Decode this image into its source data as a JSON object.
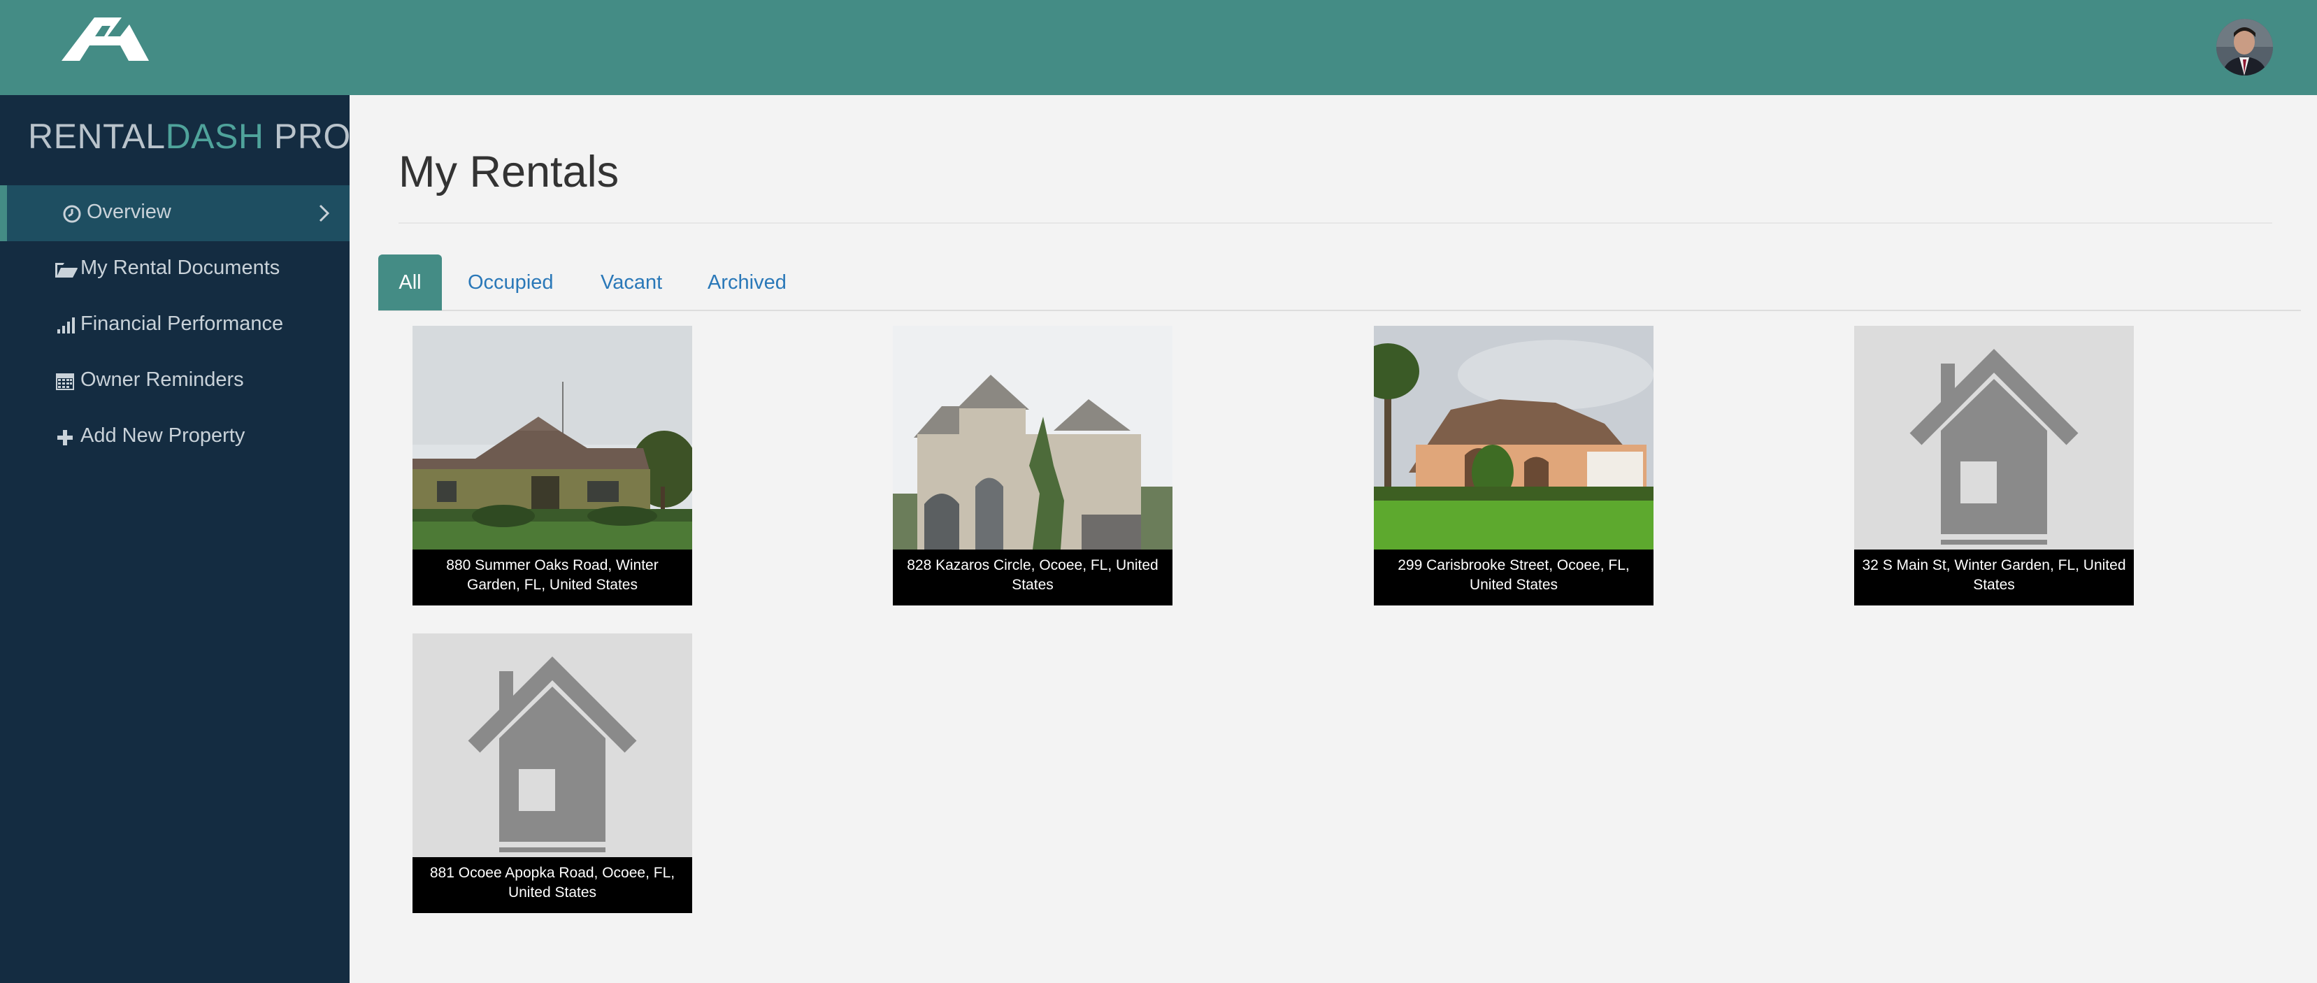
{
  "app": {
    "brand_part1": "RENTAL",
    "brand_part2": "DASH",
    "brand_part3": " PRO",
    "accent_color": "#448c85",
    "sidebar_color": "#142c41"
  },
  "header": {
    "logo_icon": "house-roof-logo-icon",
    "avatar_icon": "user-avatar"
  },
  "sidebar": {
    "items": [
      {
        "label": "Overview",
        "icon": "clock-icon",
        "active": true
      },
      {
        "label": "My Rental Documents",
        "icon": "folder-open-icon"
      },
      {
        "label": "Financial Performance",
        "icon": "bar-chart-icon"
      },
      {
        "label": "Owner Reminders",
        "icon": "calendar-icon"
      },
      {
        "label": "Add New Property",
        "icon": "plus-icon"
      }
    ]
  },
  "main": {
    "title": "My Rentals",
    "tabs": [
      {
        "label": "All",
        "active": true
      },
      {
        "label": "Occupied"
      },
      {
        "label": "Vacant"
      },
      {
        "label": "Archived"
      }
    ],
    "properties": [
      {
        "address": "880 Summer Oaks Road, Winter Garden, FL, United States",
        "image": "house-photo"
      },
      {
        "address": "828 Kazaros Circle, Ocoee, FL, United States",
        "image": "house-photo"
      },
      {
        "address": "299 Carisbrooke Street, Ocoee, FL, United States",
        "image": "house-photo"
      },
      {
        "address": "32 S Main St, Winter Garden, FL, United States",
        "image": "house-placeholder-icon"
      },
      {
        "address": "881 Ocoee Apopka Road, Ocoee, FL, United States",
        "image": "house-placeholder-icon"
      }
    ]
  }
}
